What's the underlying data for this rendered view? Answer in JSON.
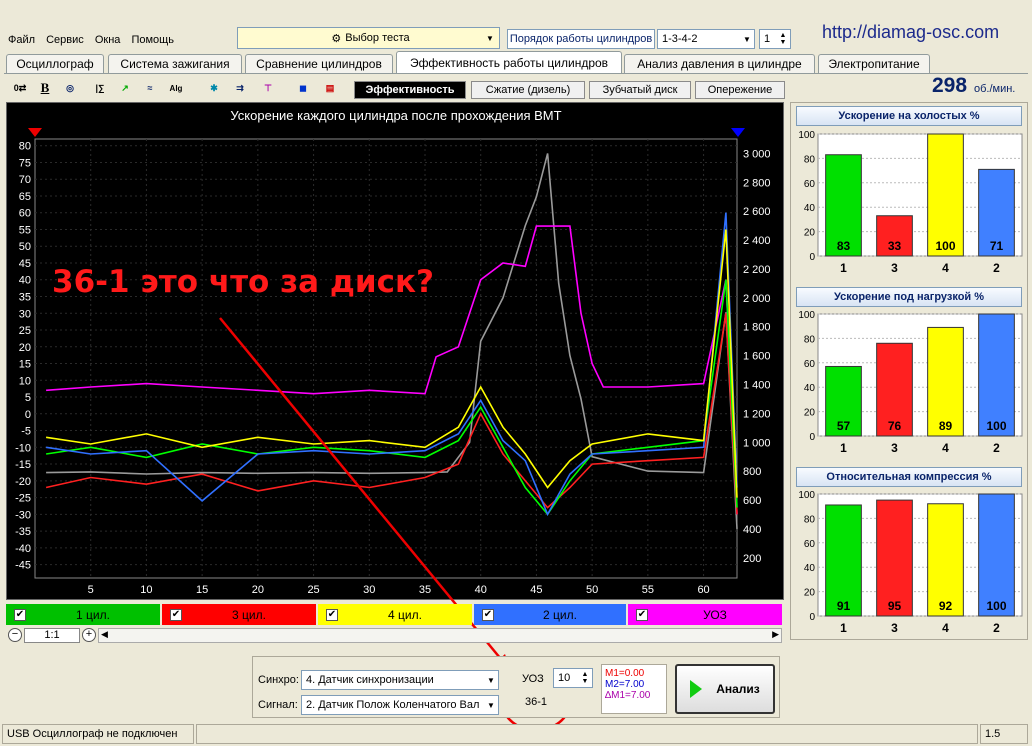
{
  "menu": {
    "items": [
      "Файл",
      "Сервис",
      "Окна",
      "Помощь"
    ]
  },
  "test_select": {
    "label": "Выбор теста"
  },
  "cyl_order": {
    "label": "Порядок работы цилиндров",
    "value": "1-3-4-2",
    "num": "1"
  },
  "site_url": "http://diamag-osc.com",
  "tabs": [
    {
      "label": "Осциллограф"
    },
    {
      "label": "Система зажигания"
    },
    {
      "label": "Сравнение цилиндров"
    },
    {
      "label": "Эффективность работы цилиндров"
    },
    {
      "label": "Анализ давления в цилиндре"
    },
    {
      "label": "Электропитание"
    }
  ],
  "rpm": {
    "value": "298",
    "unit": "об./мин."
  },
  "toolbar_icons": [
    "wave-settings",
    "bold-b",
    "rpm",
    "cylinder-marker",
    "trend",
    "vvti",
    "alg-half",
    "ignition",
    "transfer",
    "filter",
    "car",
    "table"
  ],
  "subtabs": [
    {
      "label": "Эффективность"
    },
    {
      "label": "Сжатие (дизель)"
    },
    {
      "label": "Зубчатый диск"
    },
    {
      "label": "Опережение"
    }
  ],
  "chart_title": "Ускорение каждого цилиндра после прохождения ВМТ",
  "annotation": "36-1 это что за диск?",
  "chart_data": [
    {
      "type": "line",
      "title": "Ускорение каждого цилиндра после прохождения ВМТ",
      "x_ticks": [
        5,
        10,
        15,
        20,
        25,
        30,
        35,
        40,
        45,
        50,
        55,
        60
      ],
      "y_ticks": [
        80,
        75,
        70,
        65,
        60,
        55,
        50,
        45,
        40,
        35,
        30,
        25,
        20,
        15,
        10,
        5,
        0,
        -5,
        -10,
        -15,
        -20,
        -25,
        -30,
        -35,
        -40,
        -45
      ],
      "y2_ticks": [
        "3 000",
        "2 800",
        "2 600",
        "2 400",
        "2 200",
        "2 000",
        "1 800",
        "1 600",
        "1 400",
        "1 200",
        "1 000",
        "800",
        "600",
        "400",
        "200"
      ],
      "xlim": [
        0,
        63
      ],
      "ylim": [
        -49,
        82
      ],
      "y2lim": [
        60,
        3100
      ],
      "series": [
        {
          "name": "1 цил.",
          "color": "#00ff00",
          "values": [
            [
              1,
              -12
            ],
            [
              5,
              -10
            ],
            [
              10,
              -13
            ],
            [
              15,
              -9
            ],
            [
              20,
              -12
            ],
            [
              25,
              -10
            ],
            [
              30,
              -11
            ],
            [
              35,
              -13
            ],
            [
              38,
              -8
            ],
            [
              40,
              2
            ],
            [
              42,
              -10
            ],
            [
              44,
              -22
            ],
            [
              46,
              -30
            ],
            [
              48,
              -20
            ],
            [
              50,
              -12
            ],
            [
              55,
              -10
            ],
            [
              60,
              -8
            ],
            [
              62,
              40
            ],
            [
              63,
              -28
            ]
          ]
        },
        {
          "name": "3 цил.",
          "color": "#ff2020",
          "values": [
            [
              1,
              -22
            ],
            [
              5,
              -19
            ],
            [
              10,
              -21
            ],
            [
              15,
              -18
            ],
            [
              20,
              -23
            ],
            [
              25,
              -20
            ],
            [
              30,
              -22
            ],
            [
              35,
              -19
            ],
            [
              38,
              -15
            ],
            [
              40,
              0
            ],
            [
              42,
              -12
            ],
            [
              44,
              -20
            ],
            [
              46,
              -28
            ],
            [
              48,
              -22
            ],
            [
              50,
              -15
            ],
            [
              55,
              -14
            ],
            [
              60,
              -13
            ],
            [
              62,
              30
            ],
            [
              63,
              -30
            ]
          ]
        },
        {
          "name": "4 цил.",
          "color": "#ffff00",
          "values": [
            [
              1,
              -7
            ],
            [
              5,
              -9
            ],
            [
              10,
              -6
            ],
            [
              15,
              -10
            ],
            [
              20,
              -7
            ],
            [
              25,
              -9
            ],
            [
              30,
              -8
            ],
            [
              35,
              -10
            ],
            [
              38,
              -4
            ],
            [
              40,
              8
            ],
            [
              42,
              -4
            ],
            [
              44,
              -12
            ],
            [
              46,
              -22
            ],
            [
              48,
              -14
            ],
            [
              50,
              -9
            ],
            [
              55,
              -6
            ],
            [
              60,
              -8
            ],
            [
              62,
              55
            ],
            [
              63,
              -25
            ]
          ]
        },
        {
          "name": "2 цил.",
          "color": "#3070ff",
          "values": [
            [
              1,
              -10
            ],
            [
              5,
              -12
            ],
            [
              10,
              -11
            ],
            [
              15,
              -26
            ],
            [
              20,
              -12
            ],
            [
              25,
              -11
            ],
            [
              30,
              -12
            ],
            [
              35,
              -11
            ],
            [
              38,
              -6
            ],
            [
              40,
              4
            ],
            [
              42,
              -8
            ],
            [
              44,
              -14
            ],
            [
              46,
              -30
            ],
            [
              48,
              -18
            ],
            [
              50,
              -12
            ],
            [
              55,
              -11
            ],
            [
              60,
              -10
            ],
            [
              62,
              60
            ],
            [
              63,
              -22
            ]
          ]
        },
        {
          "name": "УОЗ",
          "color": "#ff00ff",
          "values": [
            [
              1,
              7
            ],
            [
              5,
              8
            ],
            [
              10,
              9
            ],
            [
              15,
              8
            ],
            [
              20,
              7
            ],
            [
              25,
              6
            ],
            [
              30,
              7
            ],
            [
              35,
              6
            ],
            [
              36,
              17
            ],
            [
              38,
              20
            ],
            [
              40,
              40
            ],
            [
              42,
              45
            ],
            [
              44,
              44
            ],
            [
              45,
              56
            ],
            [
              48,
              56
            ],
            [
              49,
              30
            ],
            [
              50,
              15
            ],
            [
              51,
              8
            ],
            [
              55,
              8
            ],
            [
              60,
              9
            ],
            [
              62,
              40
            ],
            [
              63,
              -30
            ]
          ]
        },
        {
          "name": "RPM",
          "color": "#9a9a9a",
          "axis": "y2",
          "values": [
            [
              1,
              790
            ],
            [
              5,
              795
            ],
            [
              10,
              780
            ],
            [
              15,
              790
            ],
            [
              20,
              785
            ],
            [
              25,
              790
            ],
            [
              30,
              785
            ],
            [
              35,
              790
            ],
            [
              37,
              795
            ],
            [
              39,
              1000
            ],
            [
              40,
              1700
            ],
            [
              42,
              2000
            ],
            [
              44,
              2500
            ],
            [
              45,
              2700
            ],
            [
              46,
              3000
            ],
            [
              47,
              2100
            ],
            [
              48,
              1600
            ],
            [
              49,
              1300
            ],
            [
              50,
              900
            ],
            [
              55,
              800
            ],
            [
              60,
              790
            ],
            [
              62,
              1900
            ],
            [
              63,
              400
            ]
          ]
        }
      ]
    },
    {
      "type": "bar",
      "title": "Ускорение на холостых %",
      "categories": [
        "1",
        "3",
        "4",
        "2"
      ],
      "values": [
        83,
        33,
        100,
        71
      ],
      "colors": [
        "#00e000",
        "#ff2020",
        "#ffff00",
        "#4080ff"
      ],
      "y_ticks": [
        "100",
        "80",
        "60",
        "40",
        "20",
        "0"
      ],
      "ylim": [
        0,
        100
      ]
    },
    {
      "type": "bar",
      "title": "Ускорение под нагрузкой %",
      "categories": [
        "1",
        "3",
        "4",
        "2"
      ],
      "values": [
        57,
        76,
        89,
        100
      ],
      "colors": [
        "#00e000",
        "#ff2020",
        "#ffff00",
        "#4080ff"
      ],
      "y_ticks": [
        "100",
        "80",
        "60",
        "40",
        "20",
        "0"
      ],
      "ylim": [
        0,
        100
      ]
    },
    {
      "type": "bar",
      "title": "Относительная компрессия %",
      "categories": [
        "1",
        "3",
        "4",
        "2"
      ],
      "values": [
        91,
        95,
        92,
        100
      ],
      "colors": [
        "#00e000",
        "#ff2020",
        "#ffff00",
        "#4080ff"
      ],
      "y_ticks": [
        "100",
        "80",
        "60",
        "40",
        "20",
        "0"
      ],
      "ylim": [
        0,
        100
      ]
    }
  ],
  "legend": [
    {
      "label": "1 цил.",
      "color": "#00c000",
      "checked": "✔"
    },
    {
      "label": "3 цил.",
      "color": "#ff0000",
      "checked": "✔"
    },
    {
      "label": "4 цил.",
      "color": "#ffff00",
      "checked": "✔"
    },
    {
      "label": "2 цил.",
      "color": "#3070ff",
      "checked": "✔"
    },
    {
      "label": "УОЗ",
      "color": "#ff00ff",
      "checked": "✔"
    }
  ],
  "zoom": {
    "label": "1:1"
  },
  "sync": {
    "label": "Синхро:",
    "value": "4.  Датчик синхронизации"
  },
  "signal": {
    "label": "Сигнал:",
    "value": "2.  Датчик Полож Коленчатого Вал"
  },
  "uoz": {
    "label": "УОЗ",
    "value": "10"
  },
  "disk": {
    "value": "36-1"
  },
  "markers": {
    "m1": "M1=0.00",
    "m2": "M2=7.00",
    "dm": "∆M1=7.00"
  },
  "analyze_button": {
    "label": "Анализ"
  },
  "status_bar": {
    "text": "USB Осциллограф не подключен",
    "version": "1.5"
  }
}
